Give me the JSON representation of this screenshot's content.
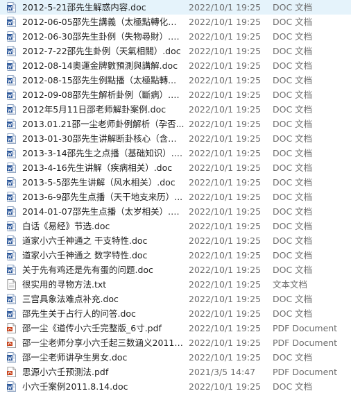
{
  "files": [
    {
      "name": "2012-5-21邵先生解惑内容.doc",
      "date": "2022/10/1 19:25",
      "type": "DOC 文档",
      "icon": "word-doc-icon"
    },
    {
      "name": "2012-06-05邵先生講義（太極點轉化）...",
      "date": "2022/10/1 19:25",
      "type": "DOC 文档",
      "icon": "word-doc-icon"
    },
    {
      "name": "2012-06-30邵先生卦例（失物尋財）.doc",
      "date": "2022/10/1 19:25",
      "type": "DOC 文档",
      "icon": "word-doc-icon"
    },
    {
      "name": "2012-7-22邵先生卦例（天氣相關）.doc",
      "date": "2022/10/1 19:25",
      "type": "DOC 文档",
      "icon": "word-doc-icon"
    },
    {
      "name": "2012-08-14奧運金牌數預測與講解.doc",
      "date": "2022/10/1 19:25",
      "type": "DOC 文档",
      "icon": "word-doc-icon"
    },
    {
      "name": "2012-08-15邵先生例點播（太極點轉...",
      "date": "2022/10/1 19:25",
      "type": "DOC 文档",
      "icon": "word-doc-icon"
    },
    {
      "name": "2012-09-08邵先生解析卦例（斷病）.doc",
      "date": "2022/10/1 19:25",
      "type": "DOC 文档",
      "icon": "word-doc-icon"
    },
    {
      "name": "2012年5月11日邵老师解卦案例.doc",
      "date": "2022/10/1 19:25",
      "type": "DOC 文档",
      "icon": "word-doc-icon"
    },
    {
      "name": "2013.01.21邵一尘老师卦例解析（孕否...",
      "date": "2022/10/1 19:25",
      "type": "DOC 文档",
      "icon": "word-doc-icon"
    },
    {
      "name": "2013-01-30邵先生讲解断卦核心（含婚...",
      "date": "2022/10/1 19:25",
      "type": "DOC 文档",
      "icon": "word-doc-icon"
    },
    {
      "name": "2013-3-14邵先生之点播（基础知识）.d...",
      "date": "2022/10/1 19:25",
      "type": "DOC 文档",
      "icon": "word-doc-icon"
    },
    {
      "name": "2013-4-16先生讲解（疾病相关）.doc",
      "date": "2022/10/1 19:25",
      "type": "DOC 文档",
      "icon": "word-doc-icon"
    },
    {
      "name": "2013-5-5邵先生讲解（风水相关）.doc",
      "date": "2022/10/1 19:25",
      "type": "DOC 文档",
      "icon": "word-doc-icon"
    },
    {
      "name": "2013-6-9邵先生点播（天干地支来历）...",
      "date": "2022/10/1 19:25",
      "type": "DOC 文档",
      "icon": "word-doc-icon"
    },
    {
      "name": "2014-01-07邵先生点播（太岁相关）.doc",
      "date": "2022/10/1 19:25",
      "type": "DOC 文档",
      "icon": "word-doc-icon"
    },
    {
      "name": "白话《易经》节选.doc",
      "date": "2022/10/1 19:25",
      "type": "DOC 文档",
      "icon": "word-doc-icon"
    },
    {
      "name": "道家小六壬神通之  干支特性.doc",
      "date": "2022/10/1 19:25",
      "type": "DOC 文档",
      "icon": "word-doc-icon"
    },
    {
      "name": "道家小六壬神通之  数字特性.doc",
      "date": "2022/10/1 19:25",
      "type": "DOC 文档",
      "icon": "word-doc-icon"
    },
    {
      "name": "关于先有鸡还是先有蛋的问题.doc",
      "date": "2022/10/1 19:25",
      "type": "DOC 文档",
      "icon": "word-doc-icon"
    },
    {
      "name": "很实用的寻物方法.txt",
      "date": "2022/10/1 19:25",
      "type": "文本文档",
      "icon": "text-file-icon"
    },
    {
      "name": "三宫具象法难点补充.doc",
      "date": "2022/10/1 19:25",
      "type": "DOC 文档",
      "icon": "word-doc-icon"
    },
    {
      "name": "邵先生关于占行人的问答.doc",
      "date": "2022/10/1 19:25",
      "type": "DOC 文档",
      "icon": "word-doc-icon"
    },
    {
      "name": "邵一尘《道传小六壬完整版_6寸.pdf",
      "date": "2022/10/1 19:25",
      "type": "PDF Document",
      "icon": "pdf-file-icon"
    },
    {
      "name": "邵一尘老师分享小六壬起三数涵义2011-...",
      "date": "2022/10/1 19:25",
      "type": "PDF Document",
      "icon": "pdf-file-icon"
    },
    {
      "name": "邵一尘老师讲孕生男女.doc",
      "date": "2022/10/1 19:25",
      "type": "DOC 文档",
      "icon": "word-doc-icon"
    },
    {
      "name": "思源小六壬预测法.pdf",
      "date": "2021/3/5 14:47",
      "type": "PDF Document",
      "icon": "pdf-file-icon"
    },
    {
      "name": "小六壬案例2011.8.14.doc",
      "date": "2022/10/1 19:25",
      "type": "DOC 文档",
      "icon": "word-doc-icon"
    }
  ],
  "colors": {
    "word": "#2b579a",
    "pdf": "#c8451e",
    "txt": "#8a8a8a",
    "hover": "#e5f3fb"
  }
}
